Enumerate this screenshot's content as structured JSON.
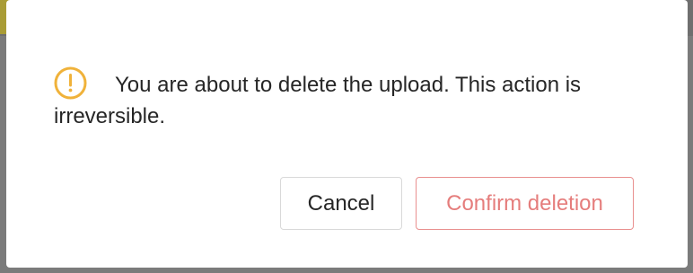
{
  "colors": {
    "warning": "#f0b23a",
    "danger": "#e57d7c",
    "text": "#262626",
    "border": "#d9d9d9"
  },
  "dialog": {
    "icon": "exclamation-circle-icon",
    "message": "You are about to delete the upload. This action is irreversible.",
    "cancel_label": "Cancel",
    "confirm_label": "Confirm deletion"
  }
}
